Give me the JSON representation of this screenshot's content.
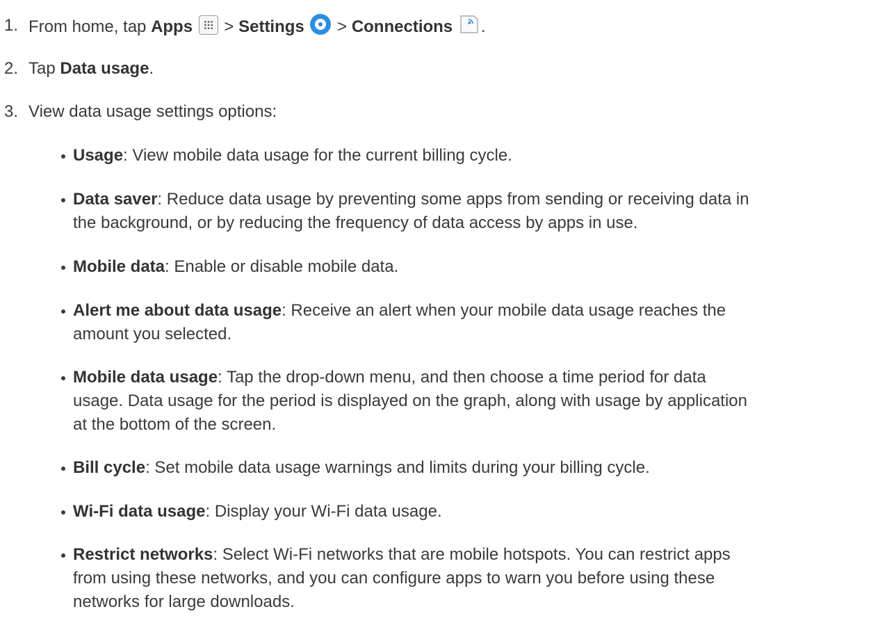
{
  "steps": [
    {
      "num": "1.",
      "pre": "From home, tap ",
      "apps": "Apps",
      "settings": "Settings",
      "connections": "Connections",
      "sep": " > ",
      "end": "."
    },
    {
      "num": "2.",
      "pre": "Tap ",
      "bold": "Data usage",
      "end": "."
    },
    {
      "num": "3.",
      "text": "View data usage settings options:"
    }
  ],
  "bullets": [
    {
      "term": "Usage",
      "lines": [
        ": View mobile data usage for the current billing cycle."
      ]
    },
    {
      "term": "Data saver",
      "lines": [
        ": Reduce data usage by preventing some apps from sending or receiving data in",
        "the background, or by reducing the frequency of data access by apps in use."
      ]
    },
    {
      "term": "Mobile data",
      "lines": [
        ": Enable or disable mobile data."
      ]
    },
    {
      "term": "Alert me about data usage",
      "lines": [
        ": Receive an alert when your mobile data usage reaches the",
        "amount you selected."
      ]
    },
    {
      "term": "Mobile data usage",
      "lines": [
        ": Tap the drop-down menu, and then choose a time period for data",
        "usage. Data usage for the period is displayed on the graph, along with usage by application",
        "at the bottom of the screen."
      ]
    },
    {
      "term": "Bill cycle",
      "lines": [
        ": Set mobile data usage warnings and limits during your billing cycle."
      ]
    },
    {
      "term": "Wi-Fi data usage",
      "lines": [
        ": Display your Wi-Fi data usage."
      ]
    },
    {
      "term": "Restrict networks",
      "lines": [
        ": Select Wi-Fi networks that are mobile hotspots. You can restrict apps",
        "from using these networks, and you can configure apps to warn you before using these",
        "networks for large downloads."
      ]
    }
  ],
  "icons": {
    "apps": "apps-grid-icon",
    "settings": "settings-gear-icon",
    "connections": "connections-icon",
    "accent": "#2a8fe0"
  }
}
